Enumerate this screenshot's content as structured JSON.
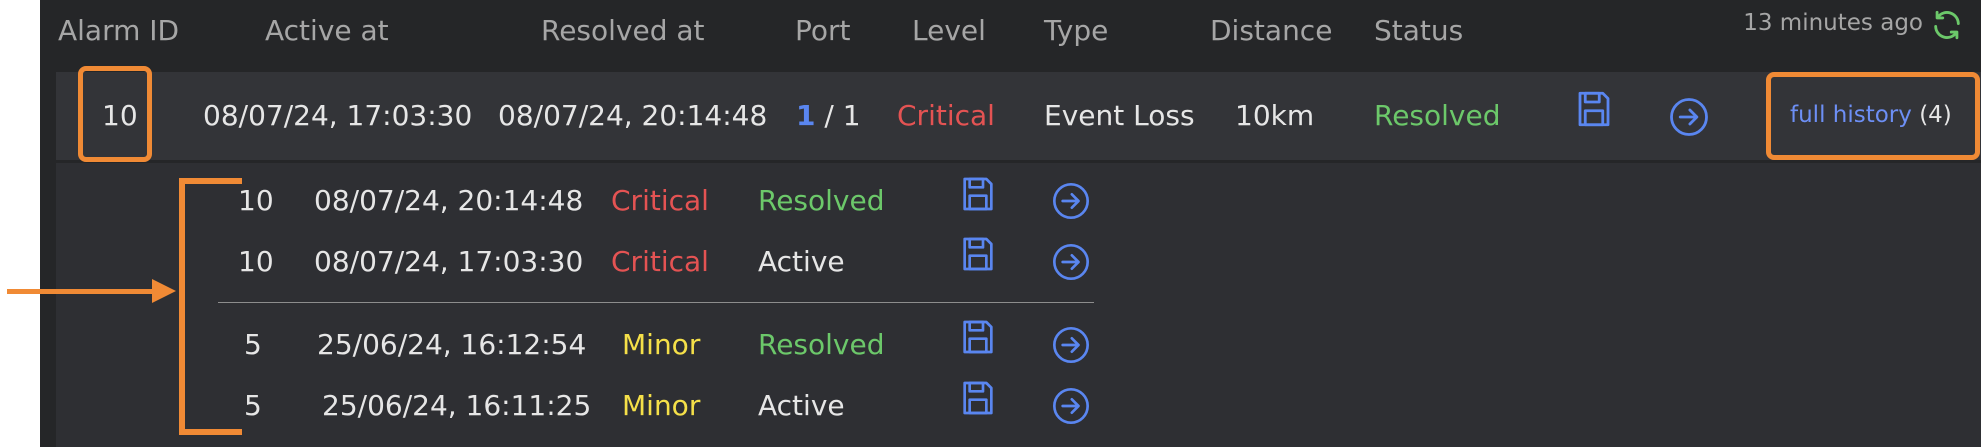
{
  "header": {
    "columns": [
      "Alarm ID",
      "Active at",
      "Resolved at",
      "Port",
      "Level",
      "Type",
      "Distance",
      "Status"
    ],
    "updated": "13 minutes ago",
    "refresh_icon": "refresh-icon"
  },
  "alarm": {
    "id": "10",
    "active_at": "08/07/24, 17:03:30",
    "resolved_at": "08/07/24, 20:14:48",
    "port_num": "1",
    "port_sep": " / 1",
    "level": "Critical",
    "type": "Event Loss",
    "distance": "10km",
    "status": "Resolved",
    "history_link": "full history",
    "history_count": "(4)",
    "save_icon": "save-icon",
    "open_icon": "arrow-right-circle-icon"
  },
  "history": [
    {
      "id": "10",
      "time": "08/07/24, 20:14:48",
      "level": "Critical",
      "status": "Resolved"
    },
    {
      "id": "10",
      "time": "08/07/24, 17:03:30",
      "level": "Critical",
      "status": "Active"
    },
    {
      "id": "5",
      "time": "25/06/24, 16:12:54",
      "level": "Minor",
      "status": "Resolved"
    },
    {
      "id": "5",
      "time": "25/06/24, 16:11:25",
      "level": "Minor",
      "status": "Active"
    }
  ],
  "colors": {
    "background": "#252628",
    "row": "#333438",
    "critical": "#e45353",
    "minor": "#f5e049",
    "resolved": "#6cc86a",
    "accent": "#5a86f0",
    "annotation": "#f08a35"
  }
}
